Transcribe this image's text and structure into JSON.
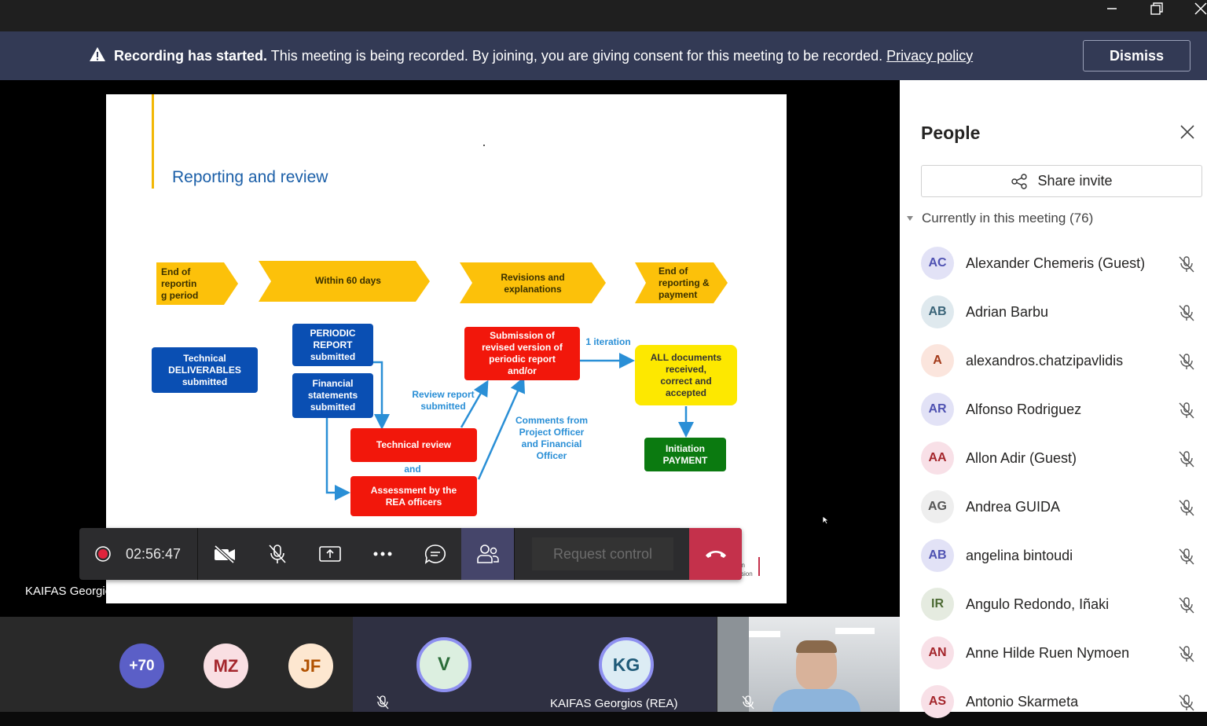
{
  "banner": {
    "bold": "Recording has started.",
    "message": " This meeting is being recorded. By joining, you are giving consent for this meeting to be recorded. ",
    "link": "Privacy policy",
    "dismiss": "Dismiss"
  },
  "slide": {
    "title": "Reporting and review",
    "phases": [
      {
        "label": "End of\nreportin\ng period"
      },
      {
        "label": "Within 60 days"
      },
      {
        "label": "Revisions and\nexplanations"
      },
      {
        "label": "End of\nreporting &\npayment"
      }
    ],
    "boxes": {
      "tech_deliverables": "Technical\nDELIVERABLES\nsubmitted",
      "periodic_report": "PERIODIC\nREPORT\nsubmitted",
      "financial": "Financial\nstatements\nsubmitted",
      "tech_review": "Technical review",
      "assessment": "Assessment by the\nREA officers",
      "submission": "Submission of\nrevised version of\nperiodic report\nand/or",
      "all_docs": "ALL documents\nreceived,\ncorrect and\naccepted",
      "initiation": "Initiation\nPAYMENT"
    },
    "notes": {
      "and": "and",
      "review_submitted": "Review report\nsubmitted",
      "iteration": "1 iteration",
      "comments": "Comments from\nProject Officer\nand Financial\nOfficer",
      "corner": "an\nssion"
    }
  },
  "toolbar": {
    "timer": "02:56:47",
    "request_control": "Request control"
  },
  "presenter_name": "KAIFAS Georgios (REA)",
  "bottom": {
    "overflow": "+70",
    "mz": "MZ",
    "jf": "JF",
    "v": "V",
    "kg": "KG",
    "kg_name": "KAIFAS Georgios (REA)"
  },
  "people": {
    "title": "People",
    "share_invite": "Share invite",
    "section": "Currently in this meeting (76)",
    "list": [
      {
        "initials": "AC",
        "name": "Alexander Chemeris (Guest)",
        "bg": "#e2e2f6",
        "fg": "#4f52b2"
      },
      {
        "initials": "AB",
        "name": "Adrian Barbu",
        "bg": "#dfe9ee",
        "fg": "#3a6478"
      },
      {
        "initials": "A",
        "name": "alexandros.chatzipavlidis",
        "bg": "#fbe5dd",
        "fg": "#a33a1a"
      },
      {
        "initials": "AR",
        "name": "Alfonso Rodriguez",
        "bg": "#e2e2f6",
        "fg": "#4f52b2"
      },
      {
        "initials": "AA",
        "name": "Allon Adir (Guest)",
        "bg": "#f8e0e7",
        "fg": "#a4262c"
      },
      {
        "initials": "AG",
        "name": "Andrea GUIDA",
        "bg": "#eeeeee",
        "fg": "#555555"
      },
      {
        "initials": "AB",
        "name": "angelina bintoudi",
        "bg": "#e2e2f6",
        "fg": "#4f52b2"
      },
      {
        "initials": "IR",
        "name": "Angulo Redondo, Iñaki",
        "bg": "#e5ebe0",
        "fg": "#4c6a33"
      },
      {
        "initials": "AN",
        "name": "Anne Hilde Ruen Nymoen",
        "bg": "#f8e0e7",
        "fg": "#a4262c"
      },
      {
        "initials": "AS",
        "name": "Antonio Skarmeta",
        "bg": "#f8e0e7",
        "fg": "#a4262c"
      }
    ]
  }
}
